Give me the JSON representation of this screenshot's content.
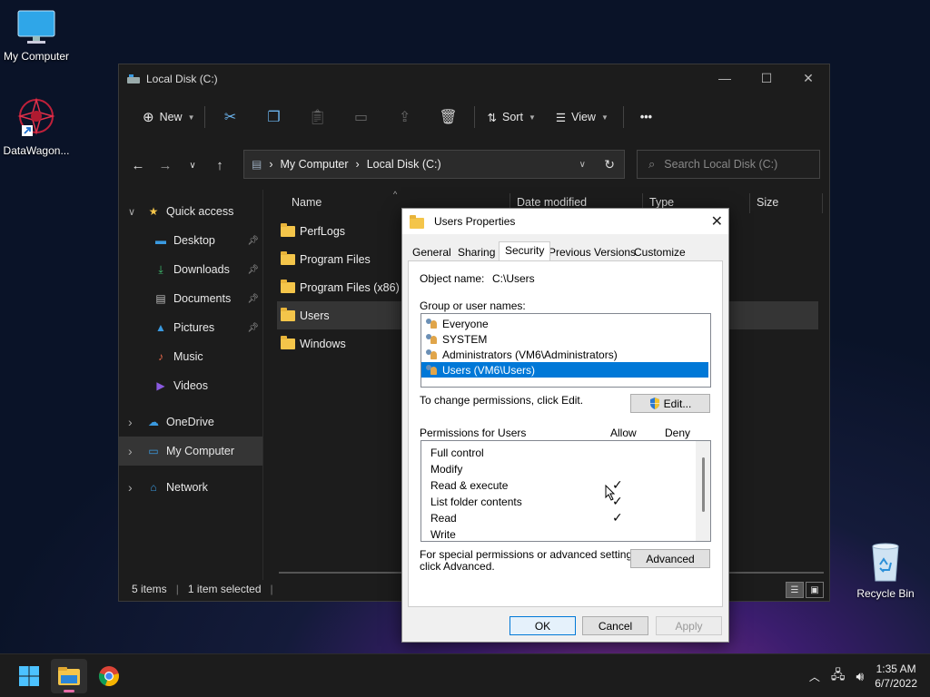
{
  "desktop": {
    "icons": [
      {
        "label": "My Computer",
        "icon": "monitor-icon"
      },
      {
        "label": "DataWagon...",
        "icon": "datawagon-logo-icon"
      },
      {
        "label": "Recycle Bin",
        "icon": "recycle-bin-icon"
      }
    ]
  },
  "explorer": {
    "title": "Local Disk (C:)",
    "commands": {
      "new": "New",
      "sort": "Sort",
      "view": "View",
      "more": "•••"
    },
    "address": {
      "crumbs": [
        "My Computer",
        "Local Disk (C:)"
      ],
      "separator": "›"
    },
    "search_placeholder": "Search Local Disk (C:)",
    "sidebar": [
      {
        "label": "Quick access",
        "icon": "star-icon",
        "expandable": true
      },
      {
        "label": "Desktop",
        "icon": "desktop-icon",
        "pinned": true
      },
      {
        "label": "Downloads",
        "icon": "download-icon",
        "pinned": true
      },
      {
        "label": "Documents",
        "icon": "document-icon",
        "pinned": true
      },
      {
        "label": "Pictures",
        "icon": "pictures-icon",
        "pinned": true
      },
      {
        "label": "Music",
        "icon": "music-icon"
      },
      {
        "label": "Videos",
        "icon": "videos-icon"
      },
      {
        "label": "OneDrive",
        "icon": "cloud-icon",
        "expandable": true
      },
      {
        "label": "My Computer",
        "icon": "computer-icon",
        "expandable": true,
        "selected": true
      },
      {
        "label": "Network",
        "icon": "network-icon",
        "expandable": true
      }
    ],
    "columns": [
      "Name",
      "Date modified",
      "Type",
      "Size"
    ],
    "files": [
      {
        "name": "PerfLogs"
      },
      {
        "name": "Program Files"
      },
      {
        "name": "Program Files (x86)"
      },
      {
        "name": "Users",
        "selected": true
      },
      {
        "name": "Windows"
      }
    ],
    "status": {
      "items": "5 items",
      "selected": "1 item selected"
    }
  },
  "dialog": {
    "title": "Users Properties",
    "tabs": [
      "General",
      "Sharing",
      "Security",
      "Previous Versions",
      "Customize"
    ],
    "active_tab": "Security",
    "object_name_label": "Object name:",
    "object_name_value": "C:\\Users",
    "group_label": "Group or user names:",
    "groups": [
      {
        "name": "Everyone"
      },
      {
        "name": "SYSTEM"
      },
      {
        "name": "Administrators (VM6\\Administrators)"
      },
      {
        "name": "Users (VM6\\Users)",
        "selected": true
      }
    ],
    "change_text": "To change permissions, click Edit.",
    "edit_button": "Edit...",
    "permissions_label": "Permissions for Users",
    "allow_label": "Allow",
    "deny_label": "Deny",
    "permissions": [
      {
        "name": "Full control",
        "allow": false
      },
      {
        "name": "Modify",
        "allow": false
      },
      {
        "name": "Read & execute",
        "allow": true
      },
      {
        "name": "List folder contents",
        "allow": true
      },
      {
        "name": "Read",
        "allow": true
      },
      {
        "name": "Write",
        "allow": false
      }
    ],
    "check_mark": "✓",
    "special_text_1": "For special permissions or advanced settings,",
    "special_text_2": "click Advanced.",
    "advanced_button": "Advanced",
    "ok_button": "OK",
    "cancel_button": "Cancel",
    "apply_button": "Apply"
  },
  "taskbar": {
    "time": "1:35 AM",
    "date": "6/7/2022"
  },
  "colors": {
    "accent": "#0078d7",
    "folder": "#f4c54a",
    "explorer_bg": "#1c1c1c"
  }
}
